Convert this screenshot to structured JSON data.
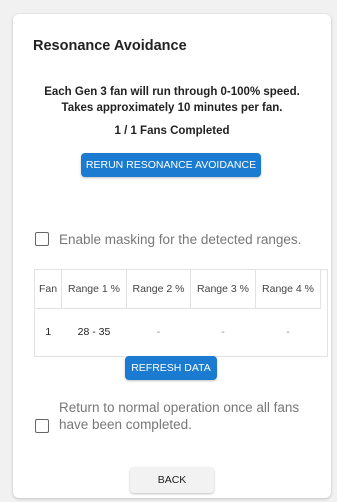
{
  "dialog": {
    "title": "Resonance Avoidance",
    "description_line1": "Each Gen 3 fan will run through 0-100% speed.",
    "description_line2": "Takes approximately 10 minutes per fan.",
    "status": "1 / 1 Fans Completed",
    "rerun_button": "RERUN RESONANCE AVOIDANCE",
    "masking_checkbox": {
      "label": "Enable masking for the detected ranges.",
      "checked": false
    },
    "table": {
      "headers": [
        "Fan",
        "Range 1 %",
        "Range 2 %",
        "Range 3 %",
        "Range 4 %"
      ],
      "rows": [
        [
          "1",
          "28 - 35",
          "-",
          "-",
          "-"
        ]
      ]
    },
    "refresh_button": "REFRESH DATA",
    "return_checkbox": {
      "label": "Return to normal operation once all fans have been completed.",
      "checked": false
    },
    "back_button": "BACK"
  },
  "colors": {
    "primary": "#1a7bd0",
    "page_background": "#f1f1f1",
    "card_background": "#ffffff"
  }
}
